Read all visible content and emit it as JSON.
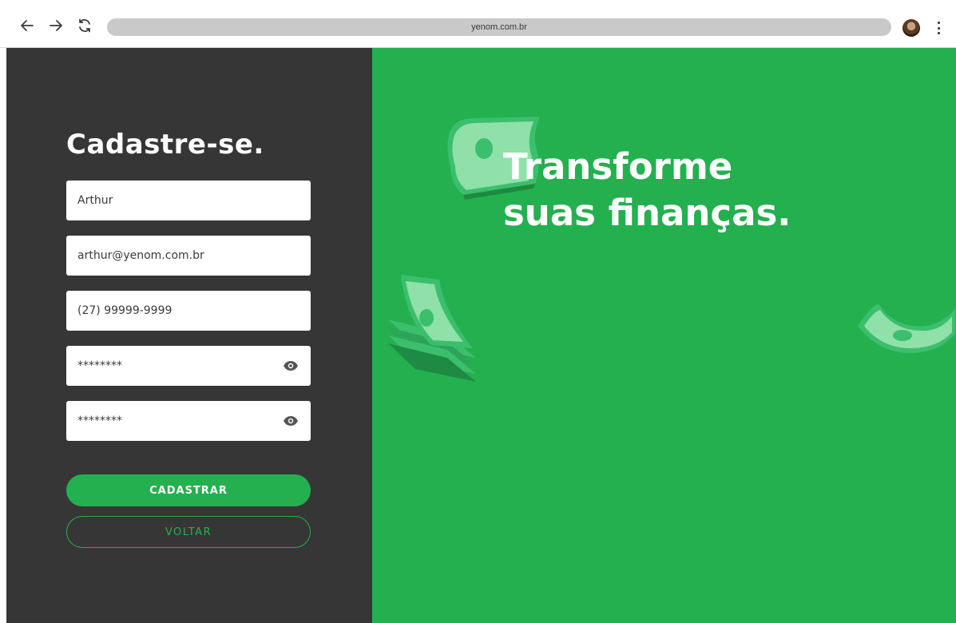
{
  "browser": {
    "url": "yenom.com.br"
  },
  "form": {
    "title": "Cadastre-se.",
    "name_value": "Arthur",
    "email_value": "arthur@yenom.com.br",
    "phone_value": "(27) 99999-9999",
    "password_value": "********",
    "confirm_password_value": "********",
    "submit_label": "CADASTRAR",
    "back_label": "VOLTAR"
  },
  "hero": {
    "line1": "Transforme",
    "line2": "suas finanças."
  },
  "colors": {
    "brand_green": "#24b04f",
    "panel_dark": "#363636"
  }
}
